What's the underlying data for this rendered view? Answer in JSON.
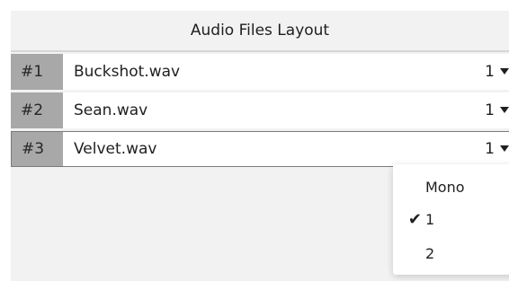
{
  "header": {
    "title": "Audio Files Layout"
  },
  "rows": [
    {
      "index": "#1",
      "file": "Buckshot.wav",
      "channel": "1"
    },
    {
      "index": "#2",
      "file": "Sean.wav",
      "channel": "1"
    },
    {
      "index": "#3",
      "file": "Velvet.wav",
      "channel": "1"
    }
  ],
  "menu": {
    "items": [
      {
        "label": "Mono",
        "checked": false
      },
      {
        "label": "1",
        "checked": true,
        "check_glyph": "✔"
      },
      {
        "label": "2",
        "checked": false
      }
    ]
  },
  "colors": {
    "panel_bg": "#f2f2f2",
    "index_bg": "#a8a8a8",
    "row_bg": "#ffffff",
    "selected_border": "#7a7a7a"
  },
  "icons": {
    "dropdown": "chevron-down-icon",
    "check": "checkmark-icon"
  }
}
